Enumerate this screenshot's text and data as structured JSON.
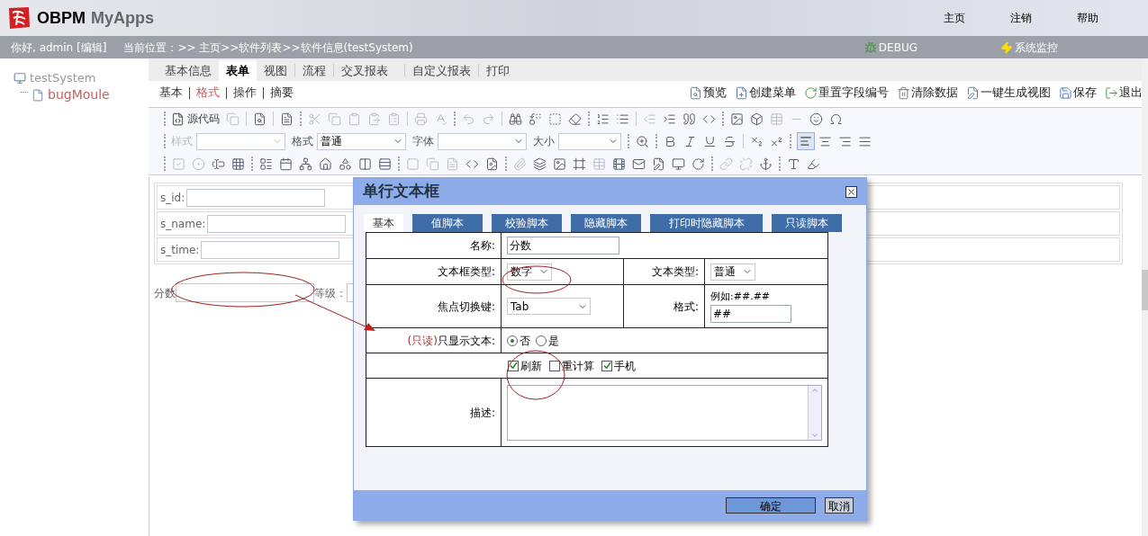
{
  "header": {
    "logo_main": "OBPM",
    "logo_sub": "MyApps",
    "links": [
      "主页",
      "注销",
      "帮助"
    ]
  },
  "info_bar": {
    "greeting": "你好, admin [编辑]",
    "location": "当前位置：>> 主页>>软件列表>>软件信息(testSystem)",
    "debug": "DEBUG",
    "monitor": "系统监控"
  },
  "tree": [
    {
      "label": "testSystem",
      "selected": false,
      "children": [
        {
          "label": "bugMoule",
          "selected": true
        }
      ]
    }
  ],
  "tabs": [
    {
      "label": "基本信息",
      "selected": false
    },
    {
      "label": "表单",
      "selected": true
    },
    {
      "label": "视图",
      "selected": false
    },
    {
      "label": "流程",
      "selected": false
    },
    {
      "label": "交叉报表",
      "selected": false
    },
    {
      "label": "自定义报表",
      "selected": false
    },
    {
      "label": "打印",
      "selected": false
    }
  ],
  "subtabs": [
    {
      "label": "基本",
      "selected": false
    },
    {
      "label": "格式",
      "selected": true
    },
    {
      "label": "操作",
      "selected": false
    },
    {
      "label": "摘要",
      "selected": false
    }
  ],
  "actions": [
    {
      "label": "预览",
      "kind": "preview"
    },
    {
      "label": "创建菜单",
      "kind": "menu"
    },
    {
      "label": "重置字段编号",
      "kind": "reset"
    },
    {
      "label": "清除数据",
      "kind": "clear"
    },
    {
      "label": "一键生成视图",
      "kind": "view"
    },
    {
      "label": "保存",
      "kind": "save"
    },
    {
      "label": "退出",
      "kind": "exit"
    }
  ],
  "editor_toolbar": {
    "source": "源代码",
    "selects": [
      {
        "label": "样式",
        "disabled": true
      },
      {
        "label": "格式",
        "value": "普通",
        "disabled": false
      },
      {
        "label": "字体",
        "disabled": false
      },
      {
        "label": "大小",
        "disabled": false
      }
    ]
  },
  "form_rows": [
    "s_id:",
    "s_name:",
    "s_time:"
  ],
  "score_label": "分数",
  "grade_label": "等级：",
  "dialog": {
    "title": "单行文本框",
    "tabs": [
      {
        "label": "基本",
        "selected": true
      },
      {
        "label": "值脚本",
        "selected": false
      },
      {
        "label": "校验脚本",
        "selected": false
      },
      {
        "label": "隐藏脚本",
        "selected": false
      },
      {
        "label": "打印时隐藏脚本",
        "selected": false
      },
      {
        "label": "只读脚本",
        "selected": false
      }
    ],
    "name_label": "名称:",
    "name_value": "分数",
    "textbox_type_label": "文本框类型:",
    "textbox_type": "数字",
    "text_type_label": "文本类型:",
    "text_type": "普通",
    "focus_key_label": "焦点切换键:",
    "focus_key": "Tab",
    "format_label": "格式:",
    "format_hint": "例如:##.##",
    "format_value": "##",
    "readonly_prefix": "(只读)",
    "readonly_label": "只显示文本:",
    "radios": [
      {
        "label": "否",
        "selected": true
      },
      {
        "label": "是",
        "selected": false
      }
    ],
    "checkboxes": [
      {
        "label": "刷新",
        "checked": true
      },
      {
        "label": "重计算",
        "checked": false
      },
      {
        "label": "手机",
        "checked": true
      }
    ],
    "description_label": "描述:",
    "buttons": [
      {
        "label": "确定",
        "kind": "primary"
      },
      {
        "label": "取消",
        "kind": "secondary"
      }
    ]
  }
}
